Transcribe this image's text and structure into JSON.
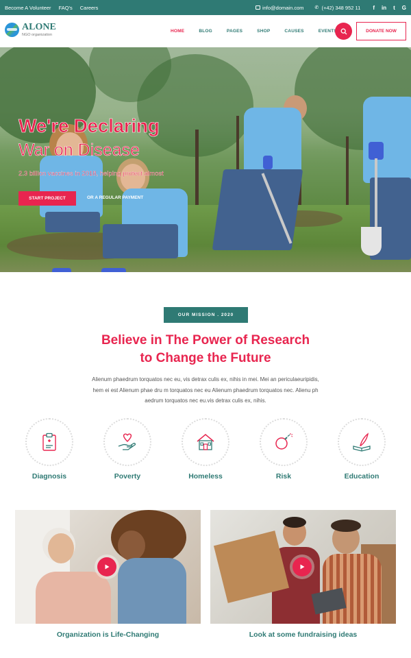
{
  "topbar": {
    "links": [
      "Become A Volunteer",
      "FAQ's",
      "Careers"
    ],
    "email": "info@domain.com",
    "phone": "(+42) 348 952 11",
    "social": [
      "f",
      "in",
      "t",
      "G"
    ]
  },
  "header": {
    "logo_title": "ALONE",
    "logo_subtitle": "NGO organization",
    "nav": [
      "HOME",
      "BLOG",
      "PAGES",
      "SHOP",
      "CAUSES",
      "EVENTS"
    ],
    "active_nav": "HOME",
    "donate_label": "DONATE NOW"
  },
  "hero": {
    "title_line1": "We're Declaring",
    "title_line2": "War on Disease",
    "subtitle": "2.3 billion vaccines in 2018, helping protect almost",
    "primary_button": "START PROJECT",
    "secondary_link": "OR A REGULAR PAYMENT"
  },
  "mission": {
    "badge": "OUR MISSION . 2020",
    "title_line1": "Believe in The Power of Research",
    "title_line2": "to Change the Future",
    "text_line1": "Alienum phaedrum torquatos nec eu, vis detrax culis ex, nihis in mei. Mei an periculaeuripidis,",
    "text_line2": "hem ei est Alienum phae dru m torquatos nec eu Alienum phaedrum torquatos nec. Alienu ph",
    "text_line3": "aedrum torquatos nec eu.vis detrax culis ex, nihis."
  },
  "causes": [
    {
      "label": "Diagnosis",
      "icon": "clipboard-icon"
    },
    {
      "label": "Poverty",
      "icon": "heart-hand-icon"
    },
    {
      "label": "Homeless",
      "icon": "house-icon"
    },
    {
      "label": "Risk",
      "icon": "bomb-icon"
    },
    {
      "label": "Education",
      "icon": "book-quill-icon"
    }
  ],
  "cards": [
    {
      "title": "Organization is Life-Changing"
    },
    {
      "title": "Look at some fundraising ideas"
    }
  ],
  "colors": {
    "brand_teal": "#2f7a74",
    "accent_red": "#e8254f"
  }
}
